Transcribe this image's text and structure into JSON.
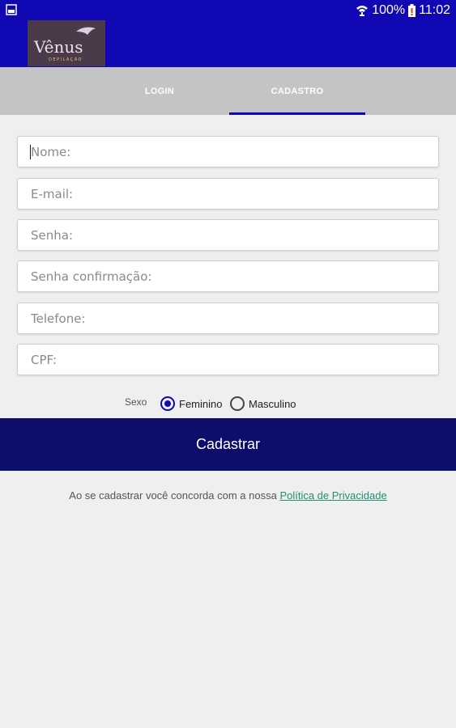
{
  "status_bar": {
    "battery_percent": "100%",
    "time": "11:02",
    "icons": [
      "gallery-icon",
      "wifi-icon",
      "battery-icon"
    ]
  },
  "app_bar": {
    "logo_text": "Vênus",
    "logo_subtext": "DEPILAÇÃO",
    "color": "#1008b2"
  },
  "tabs": [
    {
      "label": "LOGIN",
      "selected": false
    },
    {
      "label": "CADASTRO",
      "selected": true
    }
  ],
  "form": {
    "fields": [
      {
        "placeholder": "Nome:",
        "value": ""
      },
      {
        "placeholder": "E-mail:",
        "value": ""
      },
      {
        "placeholder": "Senha:",
        "value": ""
      },
      {
        "placeholder": "Senha confirmação:",
        "value": ""
      },
      {
        "placeholder": "Telefone:",
        "value": ""
      },
      {
        "placeholder": "CPF:",
        "value": ""
      }
    ],
    "gender": {
      "label": "Sexo",
      "options": [
        {
          "label": "Feminino",
          "checked": true
        },
        {
          "label": "Masculino",
          "checked": false
        }
      ]
    },
    "submit_label": "Cadastrar"
  },
  "terms": {
    "text": "Ao se cadastrar você concorda com a nossa ",
    "link": "Política de Privacidade"
  },
  "colors": {
    "primary": "#1008b2",
    "submit": "#0d0d6b",
    "link": "#1f8f72"
  }
}
